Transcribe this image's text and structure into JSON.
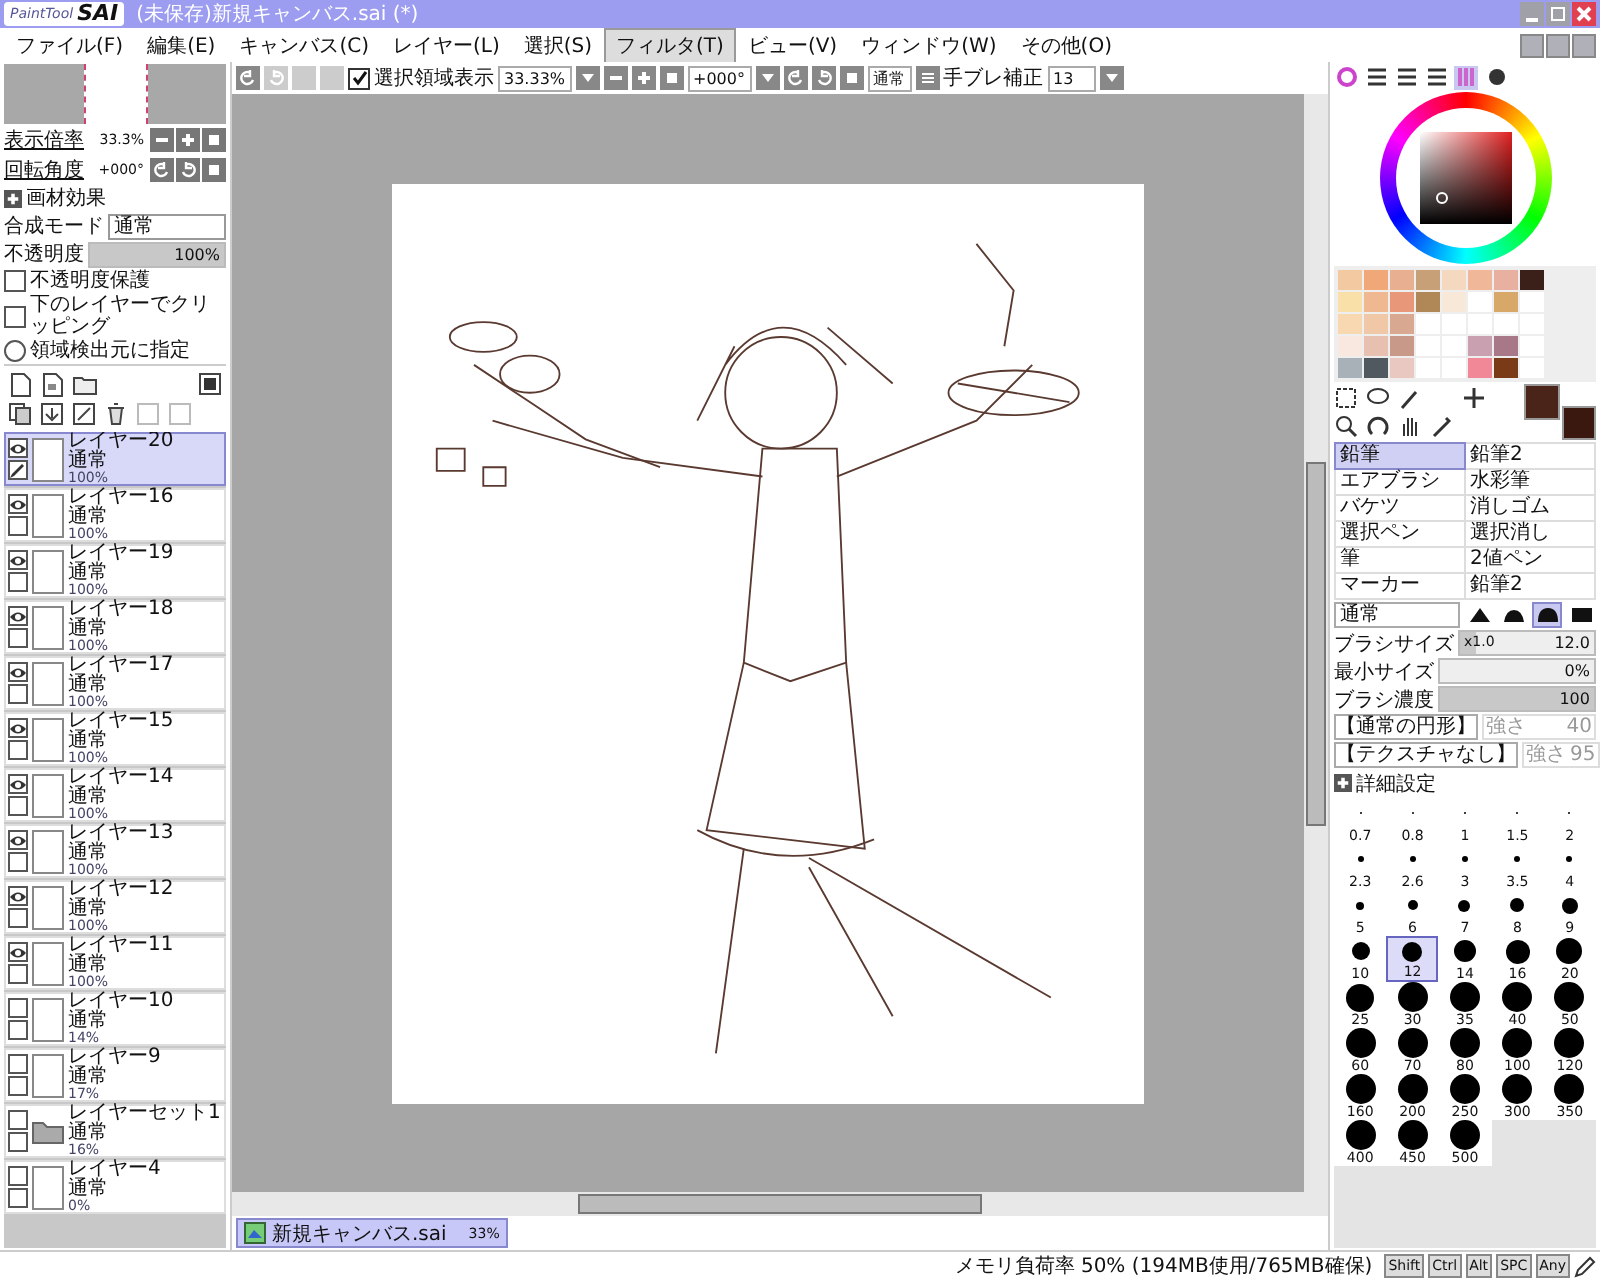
{
  "window": {
    "logo": "PaintTool",
    "logo_mark": "SAI",
    "title": "(未保存)新規キャンバス.sai (*)"
  },
  "menu": [
    {
      "label": "ファイル(F)",
      "selected": false
    },
    {
      "label": "編集(E)",
      "selected": false
    },
    {
      "label": "キャンバス(C)",
      "selected": false
    },
    {
      "label": "レイヤー(L)",
      "selected": false
    },
    {
      "label": "選択(S)",
      "selected": false
    },
    {
      "label": "フィルタ(T)",
      "selected": true
    },
    {
      "label": "ビュー(V)",
      "selected": false
    },
    {
      "label": "ウィンドウ(W)",
      "selected": false
    },
    {
      "label": "その他(O)",
      "selected": false
    }
  ],
  "navigator": {
    "zoom_label": "表示倍率",
    "zoom": "33.3%",
    "rotation_label": "回転角度",
    "rotation": "+000°"
  },
  "layer_props": {
    "effects": "画材効果",
    "blend_label": "合成モード",
    "blend": "通常",
    "opacity_label": "不透明度",
    "opacity": "100%",
    "opacity_slider": {
      "level": 1
    },
    "options": [
      {
        "kind": "checkbox",
        "label": "不透明度保護",
        "checked": false
      },
      {
        "kind": "checkbox",
        "label": "下のレイヤーでクリッピング",
        "checked": false
      },
      {
        "kind": "radio",
        "label": "領域検出元に指定",
        "checked": false
      }
    ]
  },
  "layers": [
    {
      "kind": "layer",
      "name": "レイヤー20",
      "mode": "通常",
      "opacity": "100%",
      "visible": true,
      "editing": true,
      "selected": true
    },
    {
      "kind": "layer",
      "name": "レイヤー16",
      "mode": "通常",
      "opacity": "100%",
      "visible": true,
      "editing": false,
      "selected": false
    },
    {
      "kind": "layer",
      "name": "レイヤー19",
      "mode": "通常",
      "opacity": "100%",
      "visible": true,
      "editing": false,
      "selected": false
    },
    {
      "kind": "layer",
      "name": "レイヤー18",
      "mode": "通常",
      "opacity": "100%",
      "visible": true,
      "editing": false,
      "selected": false
    },
    {
      "kind": "layer",
      "name": "レイヤー17",
      "mode": "通常",
      "opacity": "100%",
      "visible": true,
      "editing": false,
      "selected": false
    },
    {
      "kind": "layer",
      "name": "レイヤー15",
      "mode": "通常",
      "opacity": "100%",
      "visible": true,
      "editing": false,
      "selected": false
    },
    {
      "kind": "layer",
      "name": "レイヤー14",
      "mode": "通常",
      "opacity": "100%",
      "visible": true,
      "editing": false,
      "selected": false
    },
    {
      "kind": "layer",
      "name": "レイヤー13",
      "mode": "通常",
      "opacity": "100%",
      "visible": true,
      "editing": false,
      "selected": false
    },
    {
      "kind": "layer",
      "name": "レイヤー12",
      "mode": "通常",
      "opacity": "100%",
      "visible": true,
      "editing": false,
      "selected": false
    },
    {
      "kind": "layer",
      "name": "レイヤー11",
      "mode": "通常",
      "opacity": "100%",
      "visible": true,
      "editing": false,
      "selected": false
    },
    {
      "kind": "layer",
      "name": "レイヤー10",
      "mode": "通常",
      "opacity": "14%",
      "visible": false,
      "editing": false,
      "selected": false
    },
    {
      "kind": "layer",
      "name": "レイヤー9",
      "mode": "通常",
      "opacity": "17%",
      "visible": false,
      "editing": false,
      "selected": false
    },
    {
      "kind": "folder",
      "name": "レイヤーセット1",
      "mode": "通常",
      "opacity": "16%",
      "visible": false,
      "editing": false,
      "selected": false
    },
    {
      "kind": "layer",
      "name": "レイヤー4",
      "mode": "通常",
      "opacity": "0%",
      "visible": false,
      "editing": false,
      "selected": false
    }
  ],
  "toolbar": {
    "show_selection_label": "選択領域表示",
    "show_selection": true,
    "zoom": "33.33%",
    "rotation": "+000°",
    "mode": "通常",
    "stabilizer_label": "手ブレ補正",
    "stabilizer": "13"
  },
  "panel_tabs": [
    {
      "kind": "wheel",
      "selected": false
    },
    {
      "kind": "lines",
      "selected": false
    },
    {
      "kind": "lines",
      "selected": false
    },
    {
      "kind": "lines",
      "selected": false
    },
    {
      "kind": "bars",
      "selected": true
    },
    {
      "kind": "swatch",
      "selected": false
    }
  ],
  "swatches": [
    {
      "color": "#f2c9a0"
    },
    {
      "color": "#f0a878"
    },
    {
      "color": "#e8b090"
    },
    {
      "color": "#c8a078"
    },
    {
      "color": "#f4d8c0"
    },
    {
      "color": "#f0b898"
    },
    {
      "color": "#e8b0a0"
    },
    {
      "color": "#3a2018"
    },
    {
      "color": "#f8e0a8"
    },
    {
      "color": "#f0b890"
    },
    {
      "color": "#e89878"
    },
    {
      "color": "#b08858"
    },
    {
      "color": "#f8e8d8"
    },
    {
      "color": "#ffffff"
    },
    {
      "color": "#d8a868"
    },
    {
      "color": "#ffffff"
    },
    {
      "color": "#f8d8b0"
    },
    {
      "color": "#f0c8a8"
    },
    {
      "color": "#d8a890"
    },
    {
      "color": "#ffffff"
    },
    {
      "color": "#ffffff"
    },
    {
      "color": "#ffffff"
    },
    {
      "color": "#ffffff"
    },
    {
      "color": "#ffffff"
    },
    {
      "color": "#f8e8e0"
    },
    {
      "color": "#e8c0b0"
    },
    {
      "color": "#c89888"
    },
    {
      "color": "#ffffff"
    },
    {
      "color": "#ffffff"
    },
    {
      "color": "#c8a0b0"
    },
    {
      "color": "#a87888"
    },
    {
      "color": "#ffffff"
    },
    {
      "color": "#a8b0b8"
    },
    {
      "color": "#505860"
    },
    {
      "color": "#e8c8c0"
    },
    {
      "color": "#ffffff"
    },
    {
      "color": "#ffffff"
    },
    {
      "color": "#f08898"
    },
    {
      "color": "#7a3a18"
    },
    {
      "color": "#ffffff"
    }
  ],
  "colors": [
    {
      "color": "#4a2418"
    },
    {
      "color": "#3a1810"
    }
  ],
  "tools": [
    {
      "label": "鉛筆",
      "selected": true
    },
    {
      "label": "鉛筆2",
      "selected": false
    },
    {
      "label": "エアブラシ",
      "selected": false
    },
    {
      "label": "水彩筆",
      "selected": false
    },
    {
      "label": "バケツ",
      "selected": false
    },
    {
      "label": "消しゴム",
      "selected": false
    },
    {
      "label": "選択ペン",
      "selected": false
    },
    {
      "label": "選択消し",
      "selected": false
    },
    {
      "label": "筆",
      "selected": false
    },
    {
      "label": "2値ペン",
      "selected": false
    },
    {
      "label": "マーカー",
      "selected": false
    },
    {
      "label": "鉛筆2",
      "selected": false
    }
  ],
  "brush": {
    "mode": "通常",
    "edges": [
      {
        "selected": false
      },
      {
        "selected": false
      },
      {
        "selected": true
      },
      {
        "selected": false
      }
    ],
    "size_label": "ブラシサイズ",
    "size_mult": "x1.0",
    "size": "12.0",
    "size_slider": {
      "level": 0.12
    },
    "min_label": "最小サイズ",
    "min": "0%",
    "min_slider": {
      "level": 0
    },
    "density_label": "ブラシ濃度",
    "density": "100",
    "density_slider": {
      "level": 1
    },
    "shape": "【通常の円形】",
    "shape_strength_label": "強さ",
    "shape_strength": "40",
    "texture": "【テクスチャなし】",
    "texture_strength_label": "強さ",
    "texture_strength": "95",
    "advanced": "詳細設定"
  },
  "sizes": [
    {
      "label": "0.7",
      "selected": false
    },
    {
      "label": "0.8",
      "selected": false
    },
    {
      "label": "1",
      "selected": false
    },
    {
      "label": "1.5",
      "selected": false
    },
    {
      "label": "2",
      "selected": false
    },
    {
      "label": "2.3",
      "selected": false
    },
    {
      "label": "2.6",
      "selected": false
    },
    {
      "label": "3",
      "selected": false
    },
    {
      "label": "3.5",
      "selected": false
    },
    {
      "label": "4",
      "selected": false
    },
    {
      "label": "5",
      "selected": false
    },
    {
      "label": "6",
      "selected": false
    },
    {
      "label": "7",
      "selected": false
    },
    {
      "label": "8",
      "selected": false
    },
    {
      "label": "9",
      "selected": false
    },
    {
      "label": "10",
      "selected": false
    },
    {
      "label": "12",
      "selected": true
    },
    {
      "label": "14",
      "selected": false
    },
    {
      "label": "16",
      "selected": false
    },
    {
      "label": "20",
      "selected": false
    },
    {
      "label": "25",
      "selected": false
    },
    {
      "label": "30",
      "selected": false
    },
    {
      "label": "35",
      "selected": false
    },
    {
      "label": "40",
      "selected": false
    },
    {
      "label": "50",
      "selected": false
    },
    {
      "label": "60",
      "selected": false
    },
    {
      "label": "70",
      "selected": false
    },
    {
      "label": "80",
      "selected": false
    },
    {
      "label": "100",
      "selected": false
    },
    {
      "label": "120",
      "selected": false
    },
    {
      "label": "160",
      "selected": false
    },
    {
      "label": "200",
      "selected": false
    },
    {
      "label": "250",
      "selected": false
    },
    {
      "label": "300",
      "selected": false
    },
    {
      "label": "350",
      "selected": false
    },
    {
      "label": "400",
      "selected": false
    },
    {
      "label": "450",
      "selected": false
    },
    {
      "label": "500",
      "selected": false
    }
  ],
  "document_tab": {
    "name": "新規キャンバス.sai",
    "zoom": "33%"
  },
  "status_bar": {
    "memory": "メモリ負荷率 50% (194MB使用/765MB確保)",
    "keys": [
      {
        "label": "Shift",
        "on": false
      },
      {
        "label": "Ctrl",
        "on": false
      },
      {
        "label": "Alt",
        "on": false
      },
      {
        "label": "SPC",
        "on": false
      },
      {
        "label": "Any",
        "on": false
      }
    ]
  }
}
